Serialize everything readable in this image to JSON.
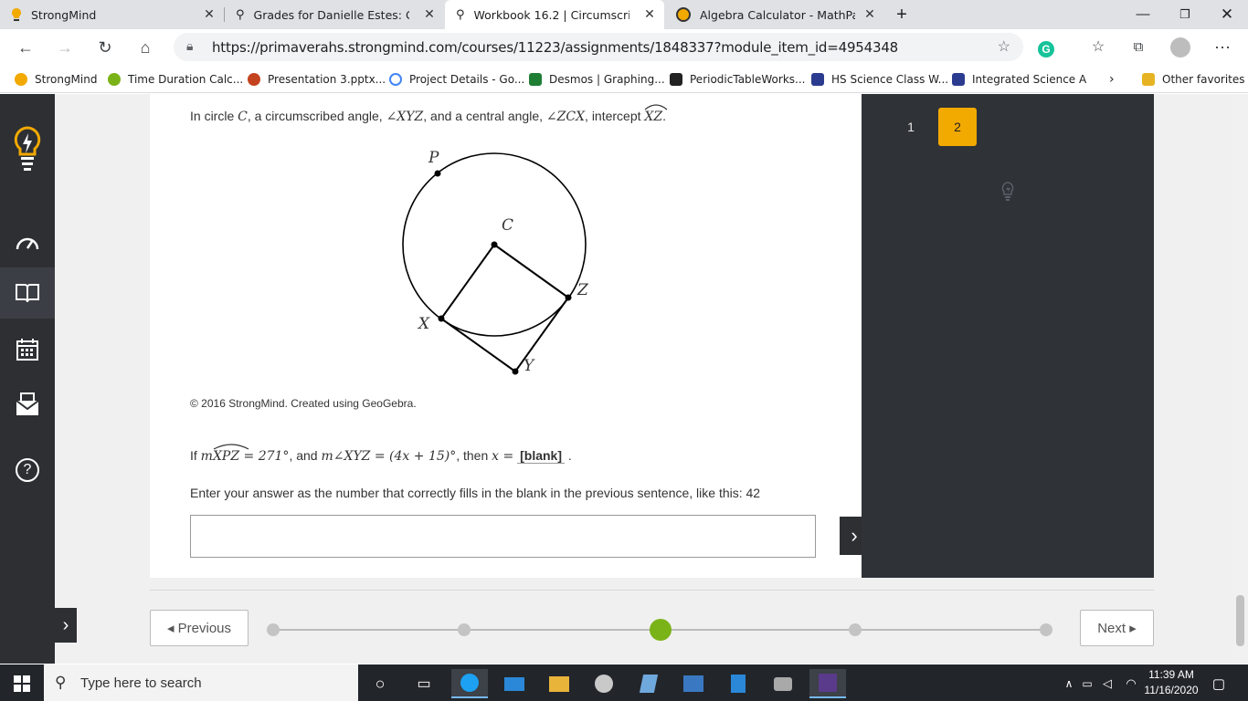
{
  "browser": {
    "tabs": [
      {
        "title": "StrongMind",
        "active": false
      },
      {
        "title": "Grades for Danielle Estes: Geo B",
        "active": false
      },
      {
        "title": "Workbook 16.2 | Circumscribed A",
        "active": true
      },
      {
        "title": "Algebra Calculator - MathPapa",
        "active": false
      }
    ],
    "new_tab": "+",
    "url": "https://primaverahs.strongmind.com/courses/11223/assignments/1848337?module_item_id=4954348",
    "bookmarks": [
      {
        "label": "StrongMind",
        "color": "#f2a900"
      },
      {
        "label": "Time Duration Calc...",
        "color": "#7ab317"
      },
      {
        "label": "Presentation 3.pptx...",
        "color": "#c4431f"
      },
      {
        "label": "Project Details - Go...",
        "color": "#4285f4"
      },
      {
        "label": "Desmos | Graphing...",
        "color": "#1e7e34"
      },
      {
        "label": "PeriodicTableWorks...",
        "color": "#222222"
      },
      {
        "label": "HS Science Class W...",
        "color": "#2b3b8f"
      },
      {
        "label": "Integrated Science A",
        "color": "#2b3b8f"
      }
    ],
    "other_favorites": "Other favorites"
  },
  "question": {
    "intro_prefix": "In circle",
    "intro_c": "C",
    "intro_mid1": ", a circumscribed angle,",
    "intro_angle1": "∠XYZ",
    "intro_mid2": ", and a central angle,",
    "intro_angle2": "∠ZCX",
    "intro_mid3": ", intercept",
    "intro_arc": "XZ",
    "intro_end": ".",
    "diagram_labels": {
      "P": "P",
      "C": "C",
      "Z": "Z",
      "X": "X",
      "Y": "Y"
    },
    "copyright": "© 2016 StrongMind. Created using GeoGebra.",
    "given_if": "If",
    "given_m1": "m",
    "given_arc": "XPZ",
    "given_eq1": " = 271°",
    "given_and": ", and",
    "given_m2": "m∠XYZ = (4x + 15)°",
    "given_then": ", then",
    "given_x": "x =",
    "blank": "[blank]",
    "given_end": ".",
    "instruction": "Enter your answer as the number that correctly fills in the blank in the previous sentence, like this: 42",
    "answer_value": ""
  },
  "question_nav": {
    "items": [
      "1",
      "2"
    ],
    "active": "2"
  },
  "pager": {
    "previous": "◂ Previous",
    "next": "Next ▸",
    "steps": 5,
    "current_step": 3
  },
  "taskbar": {
    "search_placeholder": "Type here to search",
    "time": "11:39 AM",
    "date": "11/16/2020"
  }
}
